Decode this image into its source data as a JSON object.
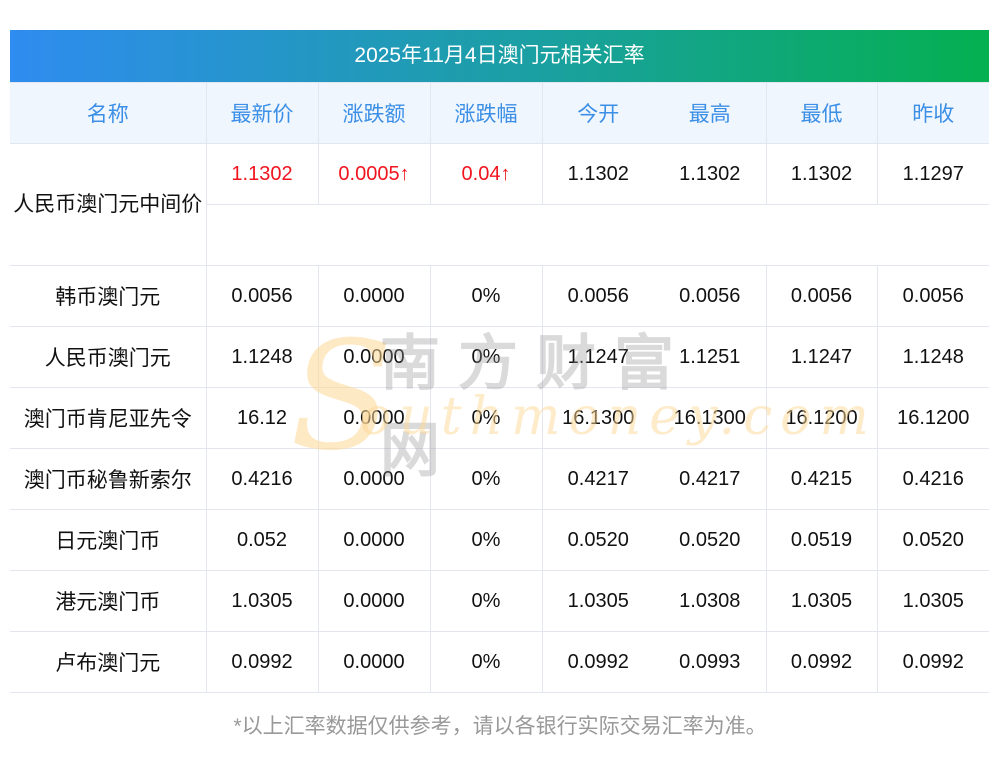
{
  "title": "2025年11月4日澳门元相关汇率",
  "headers": [
    "名称",
    "最新价",
    "涨跌额",
    "涨跌幅",
    "今开",
    "最高",
    "最低",
    "昨收"
  ],
  "rows": [
    {
      "name": "人民币澳门元中间价",
      "latest": "1.1302",
      "change": "0.0005↑",
      "pct": "0.04↑",
      "open": "1.1302",
      "high": "1.1302",
      "low": "1.1302",
      "prev": "1.1297"
    },
    {
      "name": "韩币澳门元",
      "latest": "0.0056",
      "change": "0.0000",
      "pct": "0%",
      "open": "0.0056",
      "high": "0.0056",
      "low": "0.0056",
      "prev": "0.0056"
    },
    {
      "name": "人民币澳门元",
      "latest": "1.1248",
      "change": "0.0000",
      "pct": "0%",
      "open": "1.1247",
      "high": "1.1251",
      "low": "1.1247",
      "prev": "1.1248"
    },
    {
      "name": "澳门币肯尼亚先令",
      "latest": "16.12",
      "change": "0.0000",
      "pct": "0%",
      "open": "16.1300",
      "high": "16.1300",
      "low": "16.1200",
      "prev": "16.1200"
    },
    {
      "name": "澳门币秘鲁新索尔",
      "latest": "0.4216",
      "change": "0.0000",
      "pct": "0%",
      "open": "0.4217",
      "high": "0.4217",
      "low": "0.4215",
      "prev": "0.4216"
    },
    {
      "name": "日元澳门币",
      "latest": "0.052",
      "change": "0.0000",
      "pct": "0%",
      "open": "0.0520",
      "high": "0.0520",
      "low": "0.0519",
      "prev": "0.0520"
    },
    {
      "name": "港元澳门币",
      "latest": "1.0305",
      "change": "0.0000",
      "pct": "0%",
      "open": "1.0305",
      "high": "1.0308",
      "low": "1.0305",
      "prev": "1.0305"
    },
    {
      "name": "卢布澳门元",
      "latest": "0.0992",
      "change": "0.0000",
      "pct": "0%",
      "open": "0.0992",
      "high": "0.0993",
      "low": "0.0992",
      "prev": "0.0992"
    }
  ],
  "watermark": {
    "cn": "南方财富网",
    "s": "S",
    "en": "outhmoney.com"
  },
  "footer": "*以上汇率数据仅供参考，请以各银行实际交易汇率为准。",
  "colors": {
    "up": "#f0141e",
    "header_text": "#3b8fe6",
    "gradient_start": "#2f8cf0",
    "gradient_end": "#04b050"
  }
}
